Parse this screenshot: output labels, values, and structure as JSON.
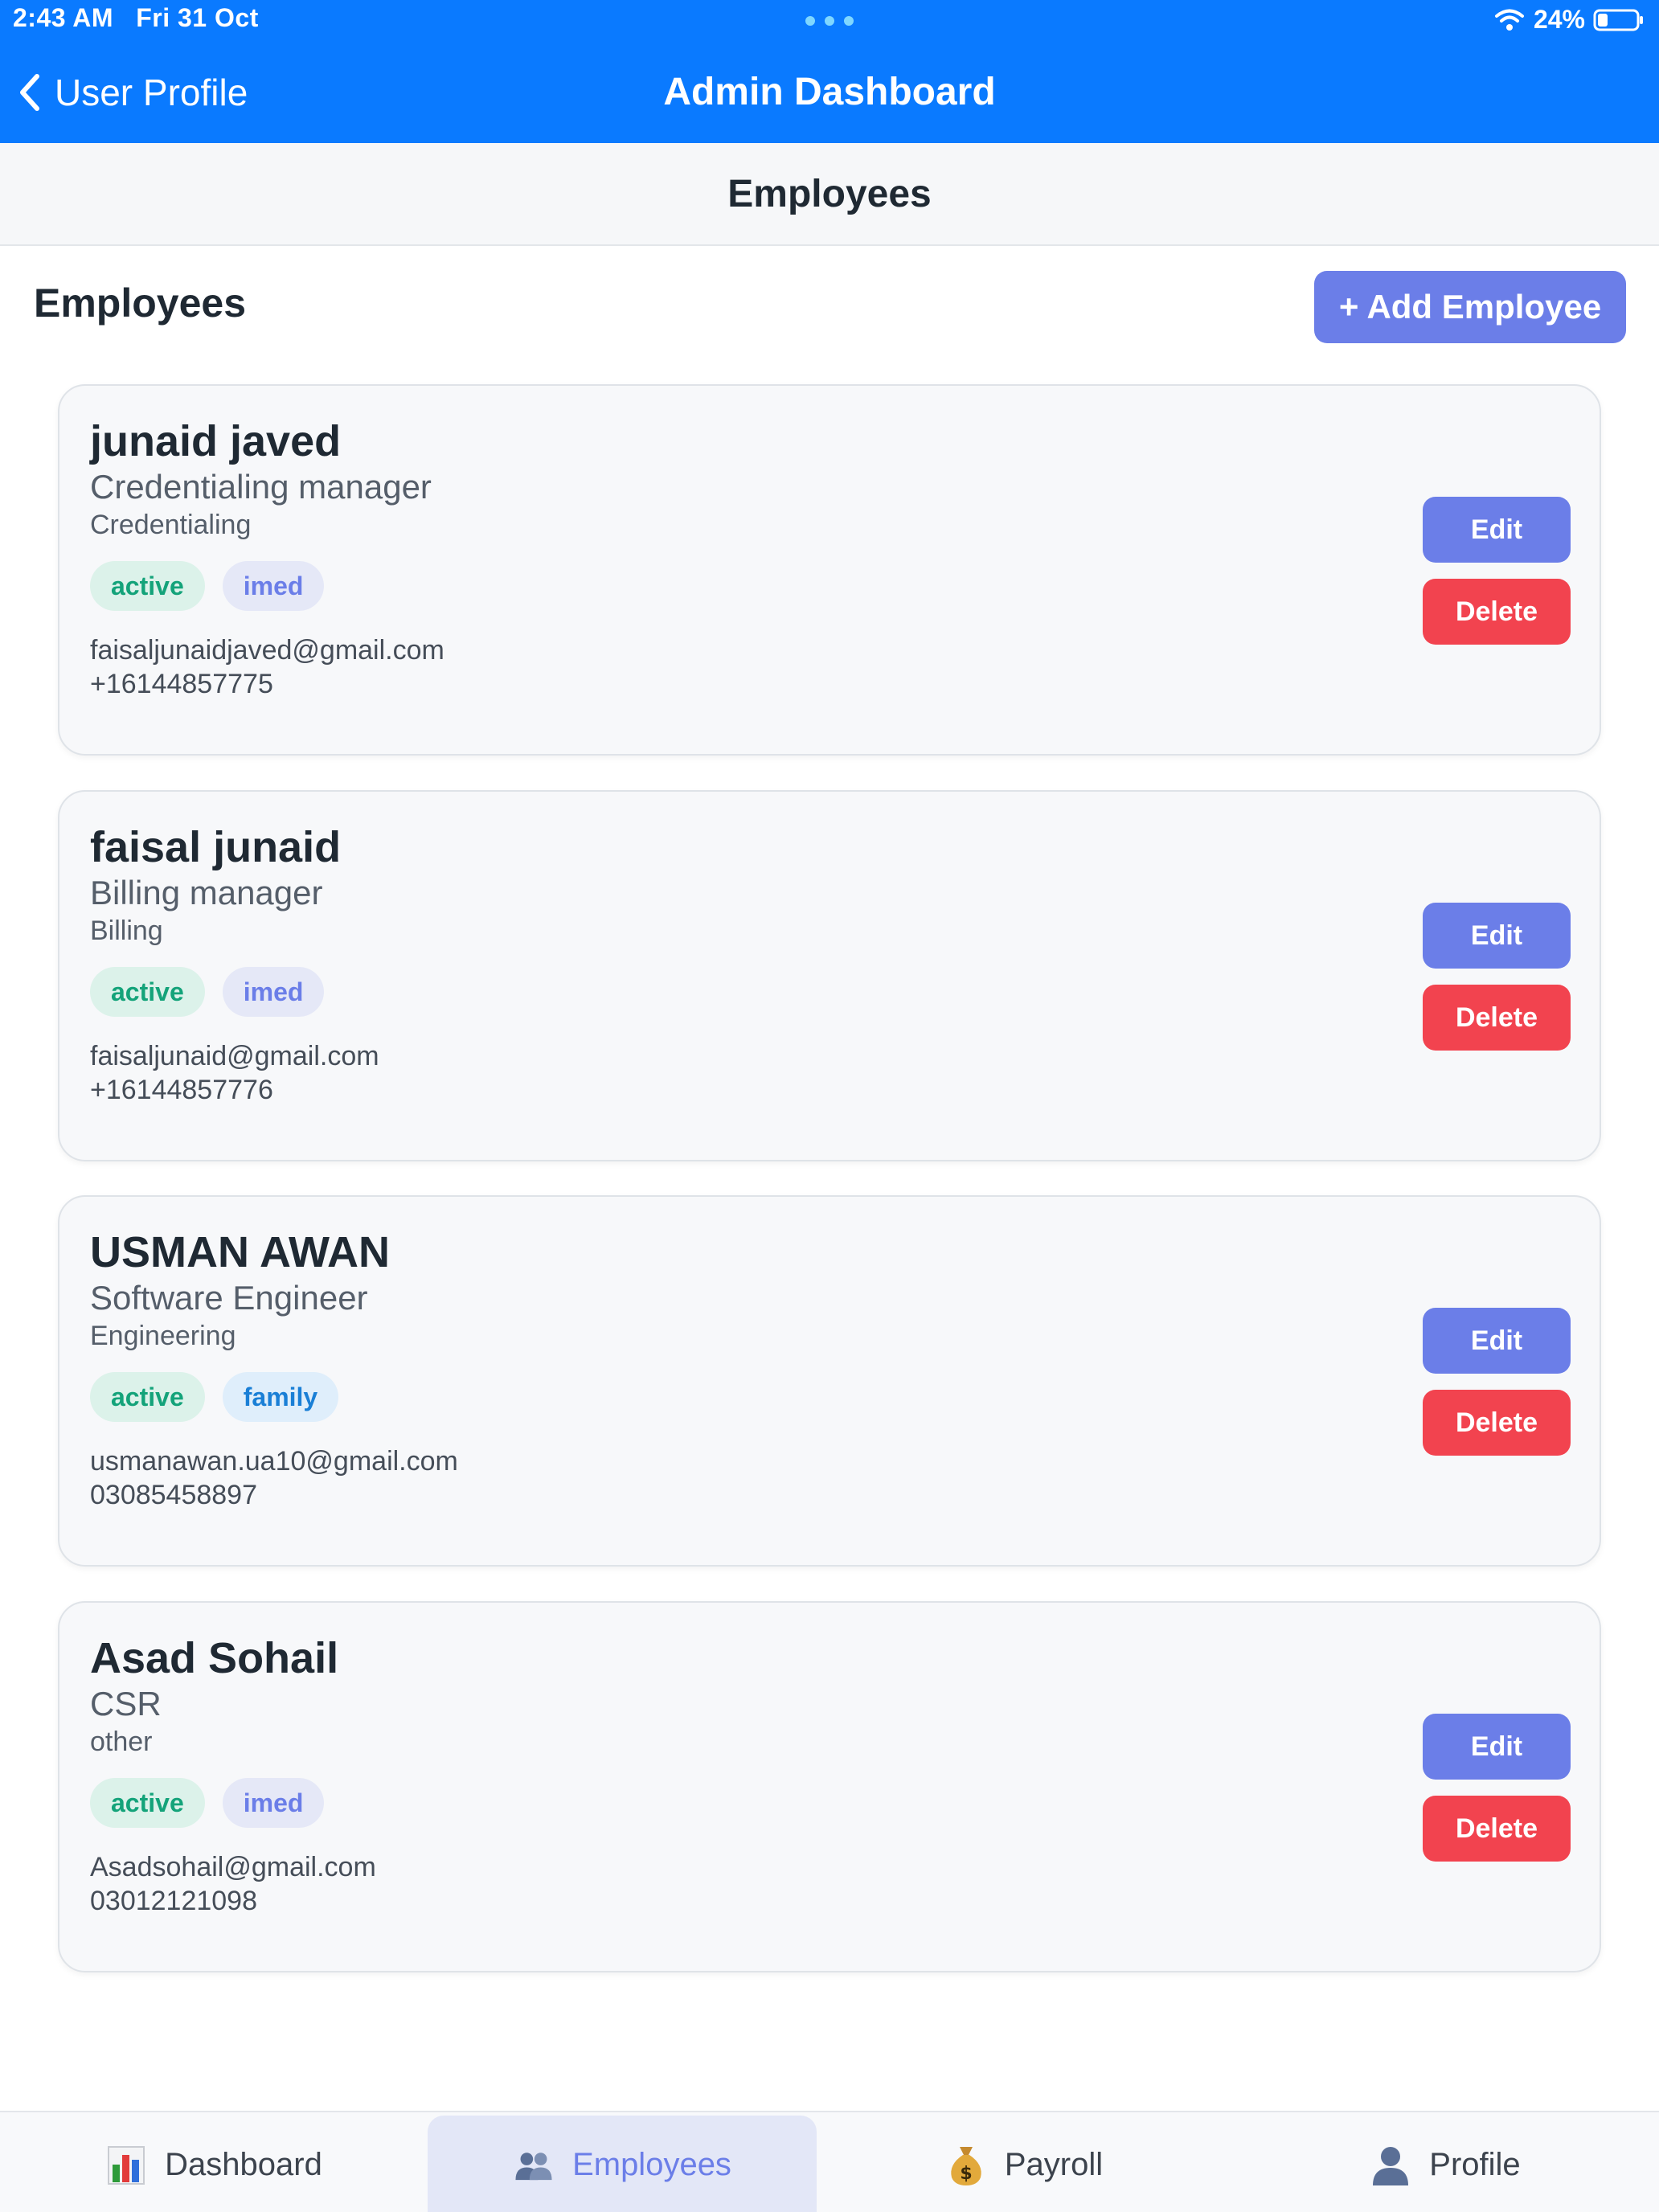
{
  "status_bar": {
    "time": "2:43 AM",
    "date": "Fri 31 Oct",
    "battery": "24%"
  },
  "nav": {
    "back_label": "User Profile",
    "title": "Admin Dashboard"
  },
  "section": {
    "title": "Employees"
  },
  "page": {
    "heading": "Employees",
    "add_button_label": "+ Add Employee"
  },
  "employees": [
    {
      "name": "junaid javed",
      "role": "Credentialing manager",
      "department": "Credentialing",
      "status": "active",
      "tag": "imed",
      "email": "faisaljunaidjaved@gmail.com",
      "phone": "+16144857775",
      "edit_label": "Edit",
      "delete_label": "Delete"
    },
    {
      "name": "faisal junaid",
      "role": "Billing manager",
      "department": "Billing",
      "status": "active",
      "tag": "imed",
      "email": "faisaljunaid@gmail.com",
      "phone": "+16144857776",
      "edit_label": "Edit",
      "delete_label": "Delete"
    },
    {
      "name": "USMAN AWAN",
      "role": "Software Engineer",
      "department": "Engineering",
      "status": "active",
      "tag": "family",
      "email": "usmanawan.ua10@gmail.com",
      "phone": "03085458897",
      "edit_label": "Edit",
      "delete_label": "Delete"
    },
    {
      "name": "Asad Sohail",
      "role": "CSR",
      "department": "other",
      "status": "active",
      "tag": "imed",
      "email": "Asadsohail@gmail.com",
      "phone": "03012121098",
      "edit_label": "Edit",
      "delete_label": "Delete"
    }
  ],
  "tabs": [
    {
      "label": "Dashboard",
      "icon": "bar-chart-icon",
      "selected": false
    },
    {
      "label": "Employees",
      "icon": "people-icon",
      "selected": true
    },
    {
      "label": "Payroll",
      "icon": "money-bag-icon",
      "selected": false
    },
    {
      "label": "Profile",
      "icon": "person-icon",
      "selected": false
    }
  ],
  "colors": {
    "nav_blue": "#0a7aff",
    "accent": "#6b7ee8",
    "danger": "#f2434f",
    "active_green": "#14a37a",
    "family_blue": "#1a7fd6"
  }
}
